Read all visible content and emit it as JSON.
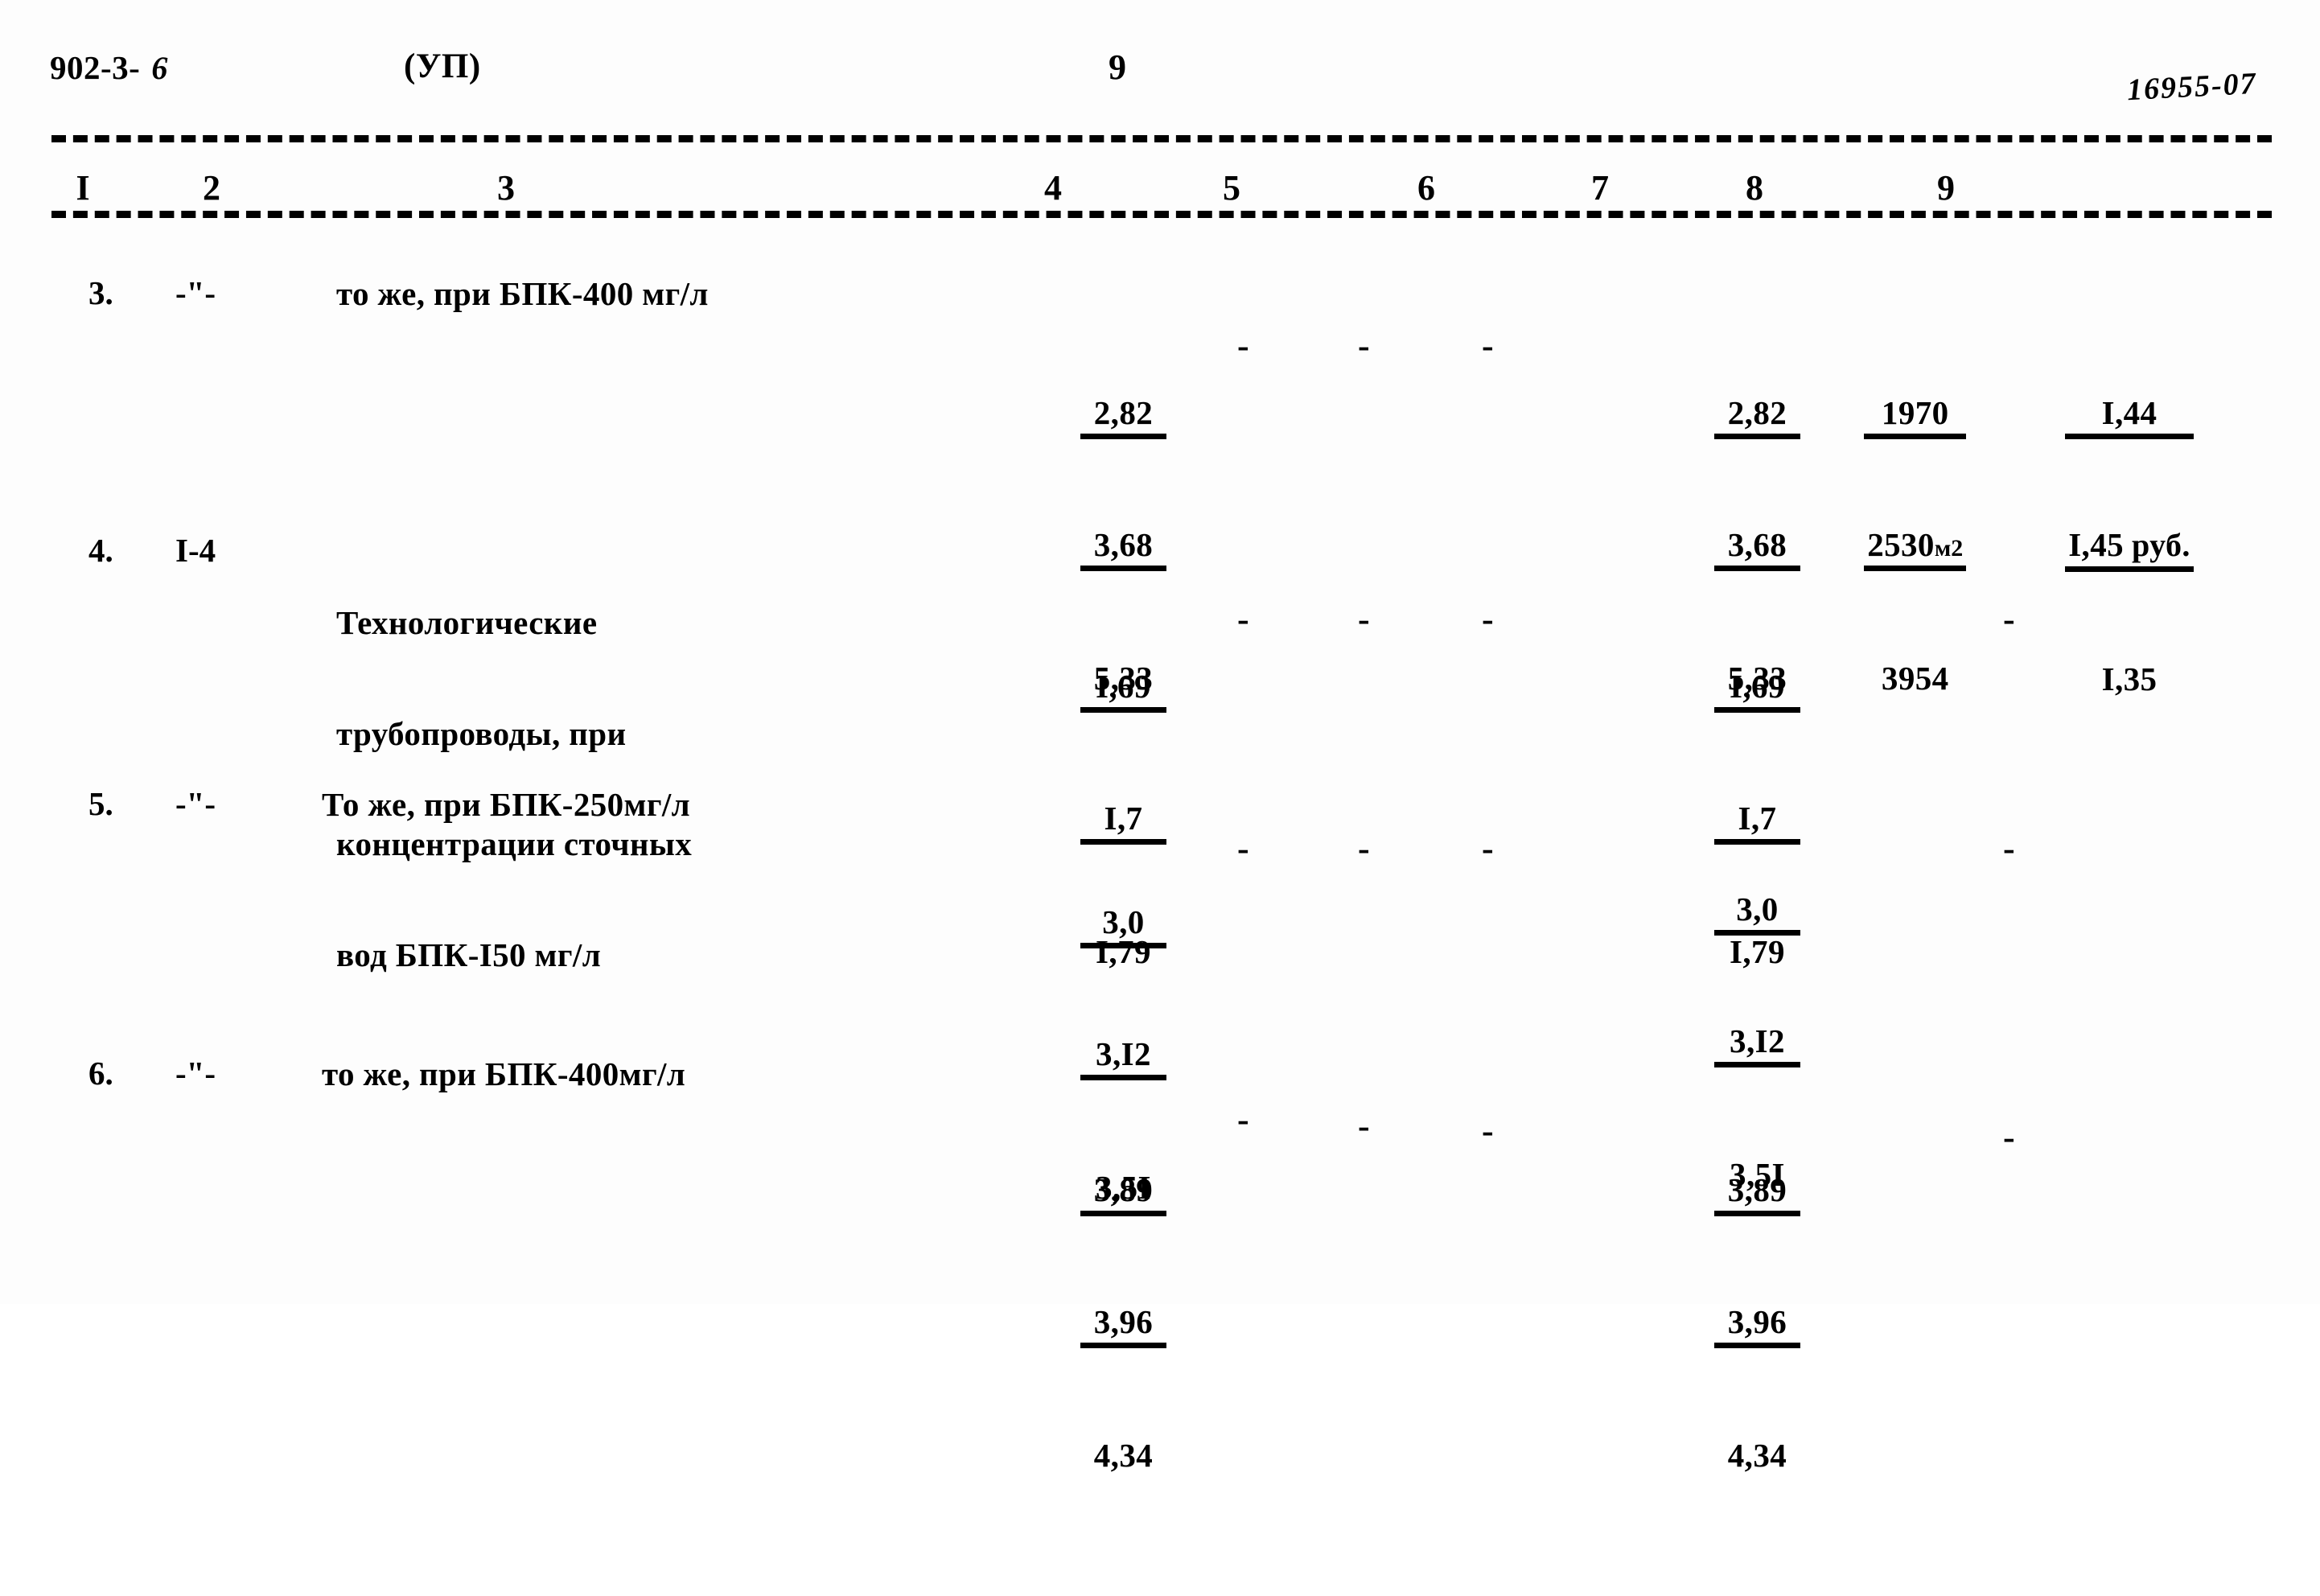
{
  "header": {
    "series": "902-3-",
    "series_suffix": "6",
    "album": "(УП)",
    "page_number": "9",
    "stamp": "16955-07"
  },
  "table": {
    "column_numbers": [
      "I",
      "2",
      "3",
      "4",
      "5",
      "6",
      "7",
      "8",
      "9"
    ],
    "dash": "-",
    "rows": [
      {
        "index": "3.",
        "code": "-\"-",
        "description": "то же, при БПК-400 мг/л",
        "col4": {
          "top": "2,82",
          "mid": "3,68",
          "bot": "5,33"
        },
        "col5": "-",
        "col6": "-",
        "col7": "-",
        "col8": {
          "top": "2,82",
          "mid": "3,68",
          "bot": "5,33"
        },
        "col9": {
          "top": "1970",
          "mid": "2530",
          "mid_unit": "м2",
          "bot": "3954"
        },
        "col10": {
          "top": "I,44",
          "mid": "I,45",
          "mid_unit": "руб.",
          "bot": "I,35"
        }
      },
      {
        "index": "4.",
        "code": "I-4",
        "description_lines": [
          "Технологические",
          "трубопроводы, при",
          "концентрации сточных",
          "вод БПК-I50 мг/л"
        ],
        "col4": {
          "top": "I,69",
          "mid": "I,7",
          "bot": "I,79"
        },
        "col5": "-",
        "col6": "-",
        "col7": "-",
        "col8": {
          "top": "I,69",
          "mid": "I,7",
          "bot": "I,79"
        },
        "col9_dash": "-"
      },
      {
        "index": "5.",
        "code": "-\"-",
        "description": "То же, при БПК-250мг/л",
        "col4": {
          "top": "3,0",
          "mid": "3,I2",
          "bot": "3,5I"
        },
        "col5": "-",
        "col6": "-",
        "col7": "-",
        "col8": {
          "top": "3,0",
          "mid": "3,I2",
          "bot": "3,5I"
        },
        "col9_dash": "-"
      },
      {
        "index": "6.",
        "code": "-\"-",
        "description": "то же, при БПК-400мг/л",
        "col4": {
          "top": "3,89",
          "mid": "3,96",
          "bot": "4,34"
        },
        "col5": "-",
        "col6": "-",
        "col7": "-",
        "col8": {
          "top": "3,89",
          "mid": "3,96",
          "bot": "4,34"
        },
        "col9_dash": "-"
      }
    ]
  }
}
